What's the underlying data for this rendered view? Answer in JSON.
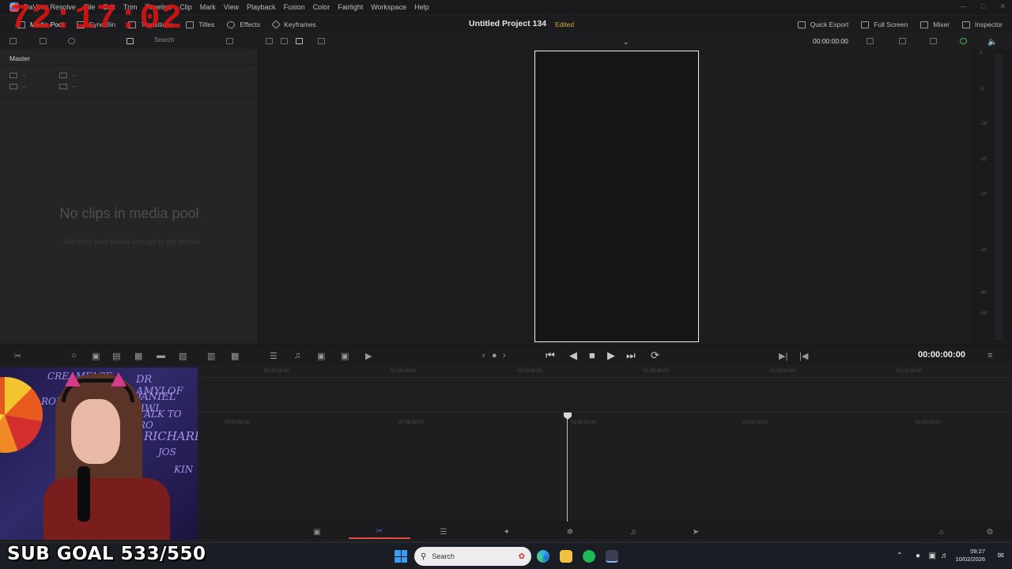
{
  "app": {
    "menu": [
      "DaVinci Resolve",
      "File",
      "Edit",
      "Trim",
      "Timeline",
      "Clip",
      "Mark",
      "View",
      "Playback",
      "Fusion",
      "Color",
      "Fairlight",
      "Workspace",
      "Help"
    ]
  },
  "toolbar": {
    "media_pool": "Media Pool",
    "sync_bin": "Sync Bin",
    "transitions": "Transitions",
    "titles": "Titles",
    "effects": "Effects",
    "keyframes": "Keyframes",
    "project_title": "Untitled Project 134",
    "edited": "Edited",
    "quick_export": "Quick Export",
    "full_screen": "Full Screen",
    "mixer": "Mixer",
    "inspector": "Inspector"
  },
  "overlay": {
    "timer": "72:17:02",
    "sub_goal": "SUB GOAL 533/550"
  },
  "media_pool": {
    "bin": "Master",
    "search_placeholder": "Search",
    "meta_placeholder": "--",
    "empty_title": "No clips in media pool",
    "empty_hint": "Add clips from Media Storage to get started"
  },
  "viewer": {
    "timecode_top": "00:00:00:00",
    "timecode_main": "00:00:00:00"
  },
  "meter": {
    "labels": [
      "0",
      "-5",
      "-10",
      "-15",
      "-20",
      "-30",
      "-40",
      "-50"
    ]
  },
  "timeline": {
    "ruler_top": [
      "01:00:18:00",
      "01:00:26:00",
      "01:00:30:00",
      "01:00:40:00",
      "01:00:50:00",
      "01:01:00:00"
    ],
    "ruler_bottom": [
      "00:59:56:00",
      "00:59:58:00",
      "01:00:00:00",
      "01:00:02:00",
      "01:00:04:00"
    ]
  },
  "pages": [
    "media",
    "cut",
    "edit",
    "fusion",
    "color",
    "fairlight",
    "deliver"
  ],
  "webcam": {
    "wall_words": [
      "DR AMYLOF",
      "DANIEL KIWI",
      "TALK TO RO",
      "RICHARD",
      "CREAMFACE",
      "ROM",
      "JOS",
      "KIN"
    ]
  },
  "taskbar": {
    "search": "Search",
    "time": "09:27",
    "date": "10/02/2026"
  },
  "colors": {
    "accent_blue": "#4b6cf0",
    "accent_red": "#e34848",
    "edited_gold": "#d3a53b"
  }
}
